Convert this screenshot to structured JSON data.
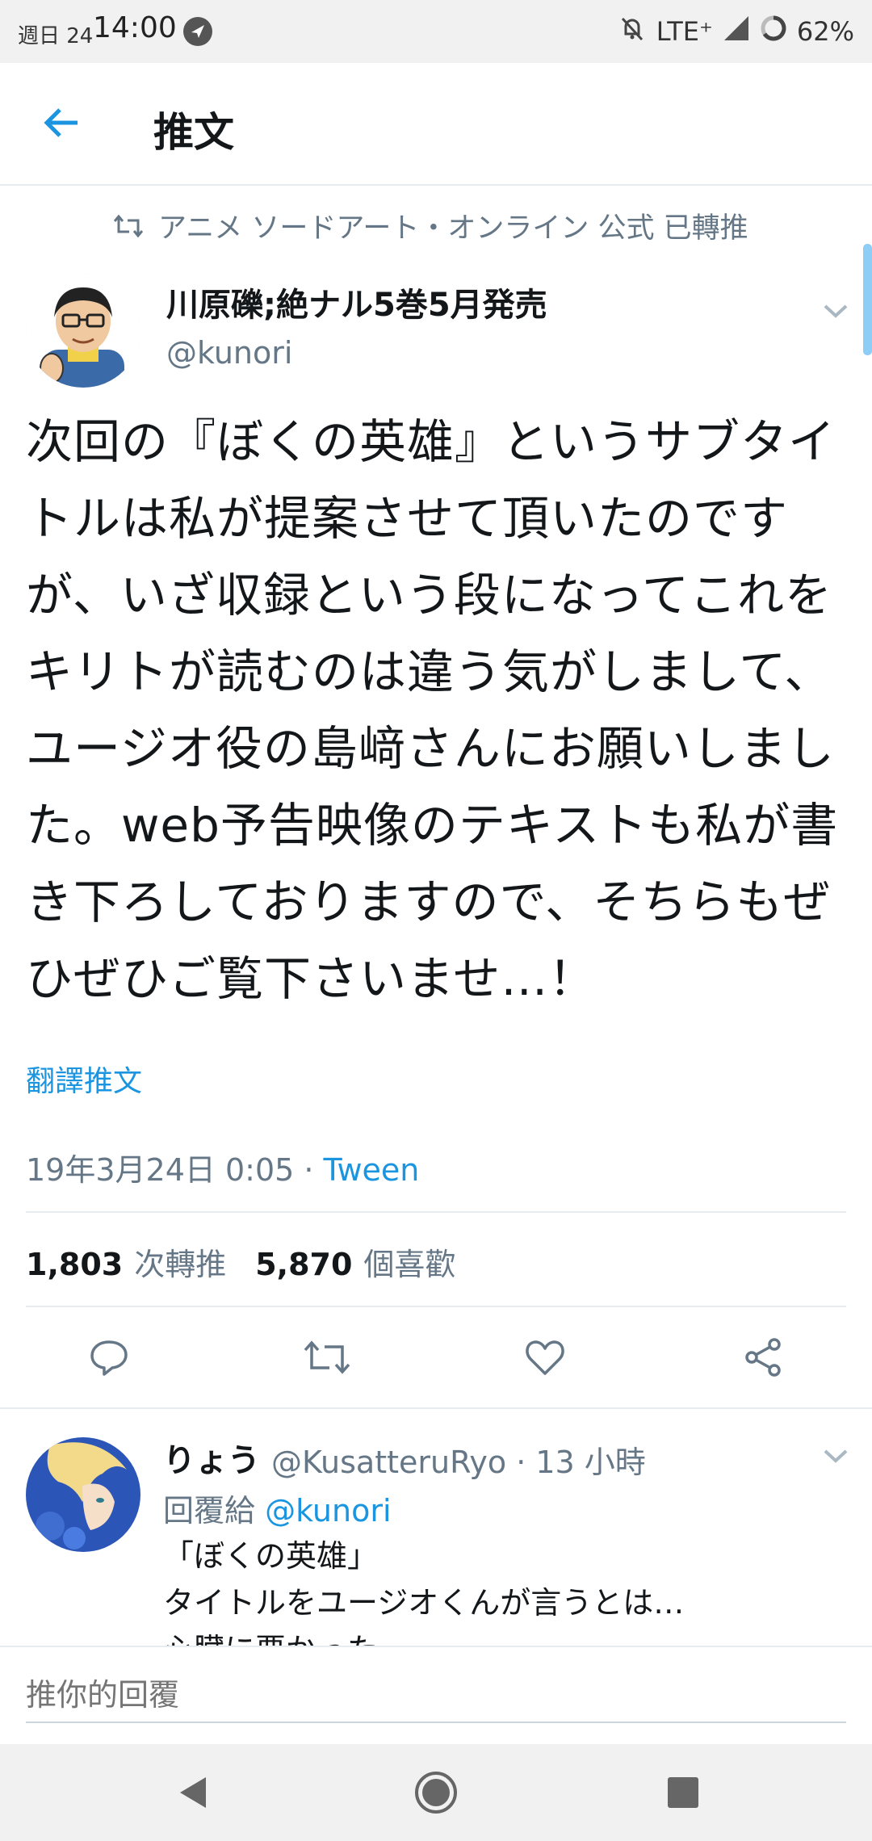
{
  "status_bar": {
    "date": "週日 24",
    "time": "14:00",
    "network": "LTE⁺",
    "battery": "62%"
  },
  "header": {
    "title": "推文"
  },
  "retweet_context": {
    "text": "アニメ ソードアート・オンライン 公式 已轉推"
  },
  "tweet": {
    "author_name": "川原礫;絶ナル5巻5月発売",
    "author_handle": "@kunori",
    "text": "次回の『ぼくの英雄』というサブタイトルは私が提案させて頂いたのですが、いざ収録という段になってこれをキリトが読むのは違う気がしまして、ユージオ役の島﨑さんにお願いしました。web予告映像のテキストも私が書き下ろしておりますので、そちらもぜひぜひご覧下さいませ…！",
    "translate_label": "翻譯推文",
    "timestamp": "19年3月24日 0:05",
    "separator": " · ",
    "source": "Tween",
    "retweet_count": "1,803",
    "retweet_label": "次轉推",
    "like_count": "5,870",
    "like_label": "個喜歡"
  },
  "reply": {
    "name": "りょう",
    "handle_time": "@KusatteruRyo · 13 小時",
    "reply_to_prefix": "回覆給 ",
    "reply_to_handle": "@kunori",
    "line1": "「ぼくの英雄」",
    "line2": "タイトルをユージオくんが言うとは…",
    "line3": "心臓に悪かった。"
  },
  "compose": {
    "placeholder": "推你的回覆"
  },
  "colors": {
    "accent": "#1b95e0",
    "secondary_text": "#657786",
    "divider": "#e6ecf0"
  },
  "icons": [
    "back-arrow-icon",
    "retweet-icon",
    "chevron-down-icon",
    "reply-icon",
    "like-icon",
    "share-icon",
    "navigation-icon",
    "mute-icon",
    "signal-icon",
    "battery-icon",
    "nav-back-icon",
    "nav-home-icon",
    "nav-recents-icon"
  ]
}
